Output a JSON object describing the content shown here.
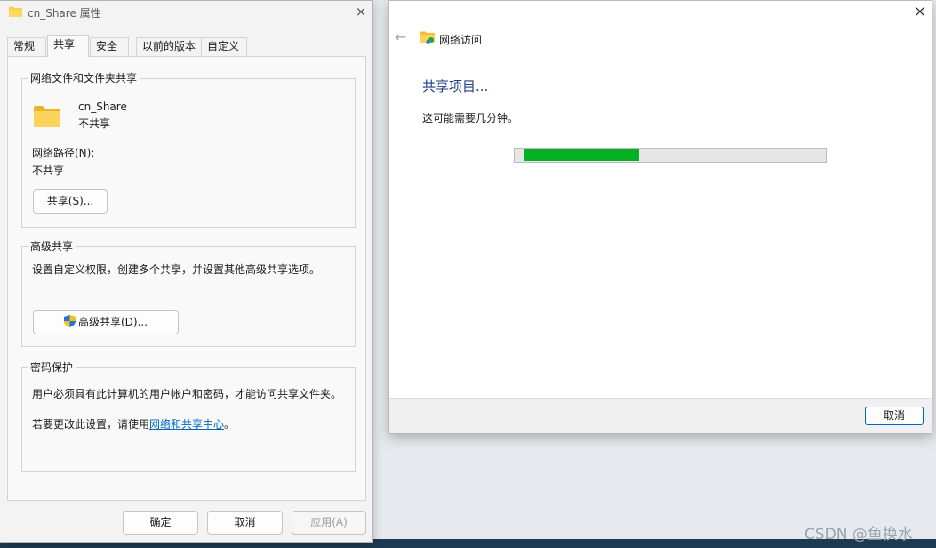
{
  "props": {
    "title": "cn_Share 属性",
    "close": "×",
    "tabs": [
      {
        "label": "常规"
      },
      {
        "label": "共享"
      },
      {
        "label": "安全"
      },
      {
        "label": "以前的版本"
      },
      {
        "label": "自定义"
      }
    ],
    "active_tab": "共享",
    "network_sharing": {
      "group_label": "网络文件和文件夹共享",
      "folder_name": "cn_Share",
      "folder_status": "不共享",
      "path_label": "网络路径(N):",
      "path_value": "不共享",
      "share_button": "共享(S)..."
    },
    "advanced_sharing": {
      "group_label": "高级共享",
      "description": "设置自定义权限，创建多个共享，并设置其他高级共享选项。",
      "button": "高级共享(D)..."
    },
    "password_protection": {
      "group_label": "密码保护",
      "description": "用户必须具有此计算机的用户帐户和密码，才能访问共享文件夹。",
      "change_prefix": "若要更改此设置，请使用",
      "link": "网络和共享中心",
      "change_suffix": "。"
    },
    "footer": {
      "ok": "确定",
      "cancel": "取消",
      "apply": "应用(A)"
    }
  },
  "wizard": {
    "close": "×",
    "back": "←",
    "title": "网络访问",
    "heading": "共享项目...",
    "description": "这可能需要几分钟。",
    "progress": 0.395,
    "cancel": "取消"
  },
  "watermark": "CSDN @鱼换水",
  "colors": {
    "progress_fill": "#06b025",
    "heading": "#1f3f86",
    "link": "#0067c0",
    "folder_yellow": "#f8cf4e"
  }
}
